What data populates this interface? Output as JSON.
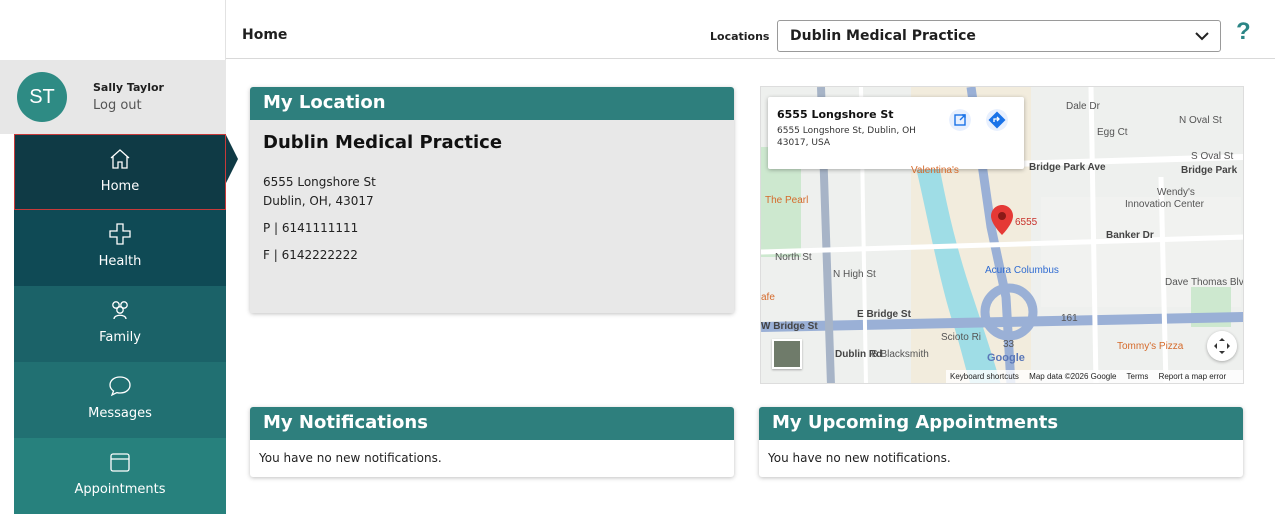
{
  "header": {
    "page_title": "Home",
    "locations_label": "Locations",
    "location_selected": "Dublin Medical Practice",
    "help_label": "?"
  },
  "user": {
    "initials": "ST",
    "name": "Sally Taylor",
    "logout_label": "Log out"
  },
  "nav": {
    "items": [
      {
        "label": "Home",
        "icon": "home-icon"
      },
      {
        "label": "Health",
        "icon": "plus-icon"
      },
      {
        "label": "Family",
        "icon": "people-icon"
      },
      {
        "label": "Messages",
        "icon": "chat-bubble-icon"
      },
      {
        "label": "Appointments",
        "icon": "calendar-icon"
      }
    ]
  },
  "my_location": {
    "title": "My Location",
    "practice_name": "Dublin Medical Practice",
    "street": "6555 Longshore St",
    "city_line": "Dublin, OH, 43017",
    "phone": "P | 6141111111",
    "fax": "F | 6142222222"
  },
  "map": {
    "popup_title": "6555 Longshore St",
    "popup_address": "6555 Longshore St, Dublin, OH 43017, USA",
    "labels": {
      "bridge_park_ave": "Bridge Park Ave",
      "s_oval_st": "S Oval St",
      "bridge_park": "Bridge Park",
      "n_oval_st": "N Oval St",
      "dale_dr": "Dale Dr",
      "egg_ct": "Egg Ct",
      "valentinas": "Valentina's",
      "the_pearl": "The Pearl",
      "wendys": "Wendy's",
      "innovation_center": "Innovation Center",
      "pin_number": "6555",
      "banker_dr": "Banker Dr",
      "north_st": "North St",
      "n_high_st": "N High St",
      "acura_columbus": "Acura Columbus",
      "dave_thomas_blvd": "Dave Thomas Blvd",
      "fe": "afe",
      "w_bridge_st": "W Bridge St",
      "e_bridge_st": "E Bridge St",
      "s_blacksmith": "S Blacksmith",
      "scioto_ri": "Scioto Ri",
      "dublin_rd": "Dublin Rd",
      "tommys_pizza": "Tommy's Pizza",
      "route_161": "161",
      "route_33": "33",
      "google": "Google"
    },
    "footer": {
      "shortcuts": "Keyboard shortcuts",
      "data": "Map data ©2026 Google",
      "terms": "Terms",
      "report": "Report a map error"
    }
  },
  "notifications": {
    "title": "My Notifications",
    "empty_text": "You have no new notifications."
  },
  "appointments": {
    "title": "My Upcoming Appointments",
    "empty_text": "You have no new notifications."
  },
  "colors": {
    "teal": "#2e7f7d",
    "nav_active": "#0f3a45",
    "help": "#2b8585",
    "pin": "#e53935"
  }
}
